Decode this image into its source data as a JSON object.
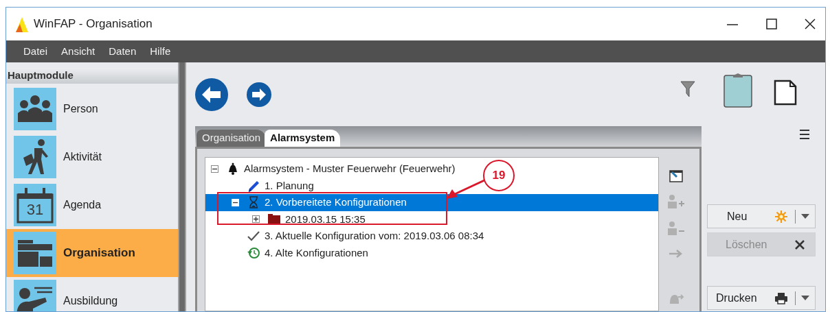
{
  "window": {
    "title": "WinFAP - Organisation"
  },
  "menu": [
    "Datei",
    "Ansicht",
    "Daten",
    "Hilfe"
  ],
  "sidebar": {
    "header": "Hauptmodule",
    "items": [
      {
        "label": "Person",
        "kind": "people",
        "selected": false
      },
      {
        "label": "Aktivität",
        "kind": "walker",
        "selected": false
      },
      {
        "label": "Agenda",
        "kind": "calendar",
        "badge": "31",
        "selected": false
      },
      {
        "label": "Organisation",
        "kind": "folders",
        "selected": true
      },
      {
        "label": "Ausbildung",
        "kind": "trainer",
        "selected": false
      }
    ]
  },
  "tabs": [
    {
      "label": "Organisation",
      "selected": false
    },
    {
      "label": "Alarmsystem",
      "selected": true
    }
  ],
  "tree": {
    "nodes": [
      {
        "label": "Alarmsystem - Muster Feuerwehr (Feuerwehr)",
        "kind": "bell",
        "expanded": true,
        "selected": false,
        "children": [
          {
            "label": "1. Planung",
            "kind": "pencil",
            "selected": false
          },
          {
            "label": "2. Vorbereitete Konfigurationen",
            "kind": "hourglass",
            "expanded": true,
            "selected": true,
            "children": [
              {
                "label": "2019.03.15 15:35",
                "kind": "folder",
                "expanded": false,
                "selected": false
              }
            ]
          },
          {
            "label": "3. Aktuelle Konfiguration vom: 2019.03.06 08:34",
            "kind": "check",
            "selected": false
          },
          {
            "label": "4. Alte Konfigurationen",
            "kind": "history",
            "selected": false
          }
        ]
      }
    ]
  },
  "buttons": [
    {
      "label": "Neu",
      "kind": "sun",
      "dropdown": true,
      "disabled": false
    },
    {
      "label": "Löschen",
      "kind": "cross",
      "dropdown": false,
      "disabled": true
    },
    {
      "label": "Drucken",
      "kind": "printer",
      "dropdown": true,
      "disabled": false
    }
  ],
  "callout": {
    "label": "19"
  }
}
